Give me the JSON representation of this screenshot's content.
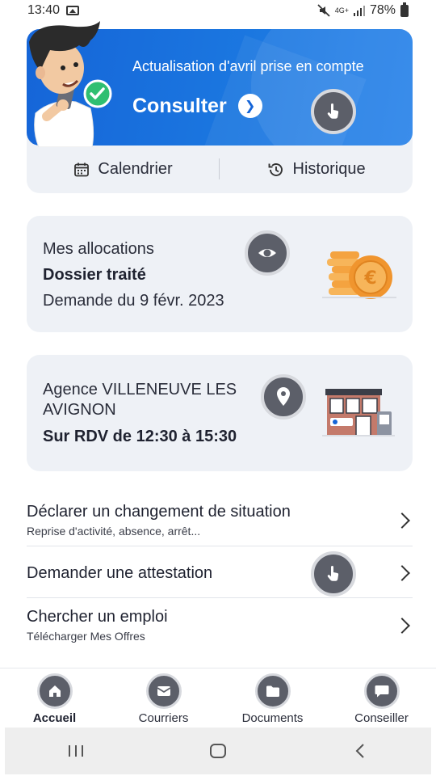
{
  "status_bar": {
    "time": "13:40",
    "network": "4G+",
    "battery": "78%"
  },
  "hero": {
    "subtitle": "Actualisation d'avril prise en compte",
    "consult_label": "Consulter",
    "calendar_label": "Calendrier",
    "history_label": "Historique"
  },
  "allocations": {
    "title": "Mes allocations",
    "status": "Dossier traité",
    "date": "Demande du 9 févr. 2023"
  },
  "agency": {
    "title_line1": "Agence VILLENEUVE LES",
    "title_line2": "AVIGNON",
    "schedule": "Sur RDV de 12:30 à 15:30"
  },
  "list": [
    {
      "title": "Déclarer un changement de situation",
      "subtitle": "Reprise d'activité, absence, arrêt..."
    },
    {
      "title": "Demander une attestation",
      "subtitle": ""
    },
    {
      "title": "Chercher un emploi",
      "subtitle": "Télécharger Mes Offres"
    }
  ],
  "bottom_nav": [
    {
      "label": "Accueil",
      "icon": "home-icon",
      "active": true
    },
    {
      "label": "Courriers",
      "icon": "mail-icon",
      "active": false
    },
    {
      "label": "Documents",
      "icon": "folder-icon",
      "active": false
    },
    {
      "label": "Conseiller",
      "icon": "chat-icon",
      "active": false
    }
  ],
  "colors": {
    "brand_blue": "#1565d8",
    "card_bg": "#eef1f6",
    "bubble_dark": "#5c5f69",
    "success_green": "#2fbf71",
    "coin_orange": "#f4a340"
  }
}
